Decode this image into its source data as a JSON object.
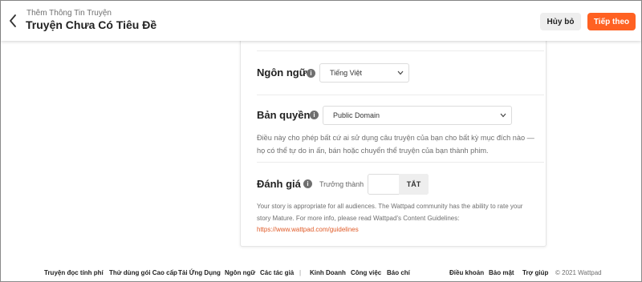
{
  "header": {
    "subtitle": "Thêm Thông Tin Truyện",
    "title": "Truyện Chưa Có Tiêu Đề",
    "cancel_label": "Hủy bỏ",
    "next_label": "Tiếp theo"
  },
  "colors": {
    "accent": "#ff6122",
    "link": "#e05a27",
    "muted_text": "#6f6f6f"
  },
  "form": {
    "language": {
      "label": "Ngôn ngữ",
      "info_icon": "i",
      "selected": "Tiếng Việt"
    },
    "copyright": {
      "label": "Bản quyền",
      "info_icon": "i",
      "selected": "Public Domain",
      "description_line1": "Điều này cho phép bất cứ ai sử dụng câu truyện của bạn cho bất kỳ mục đích nào —",
      "description_line2": "họ có thể tự do in ấn, bán hoặc chuyển thể truyện của bạn thành phim."
    },
    "rating": {
      "label": "Đánh giá",
      "info_icon": "i",
      "mature_label": "Trưởng thành",
      "toggle_state": "TẮT",
      "description_line1": "Your story is appropriate for all audiences. The Wattpad community has the ability to rate your",
      "description_line2": "story Mature. For more info, please read Wattpad's Content Guidelines:",
      "guidelines_link": "https://www.wattpad.com/guidelines"
    }
  },
  "footer": {
    "links": [
      "Truyện đọc tính phí",
      "Thử dùng gói Cao cấp",
      "Tải Ứng Dụng",
      "Ngôn ngữ",
      "Các tác giả"
    ],
    "separator": "|",
    "links2": [
      "Kinh Doanh",
      "Công việc",
      "Báo chí"
    ],
    "links3": [
      "Điều khoản",
      "Bảo mật",
      "Trợ giúp"
    ],
    "copyright": "© 2021 Wattpad"
  }
}
